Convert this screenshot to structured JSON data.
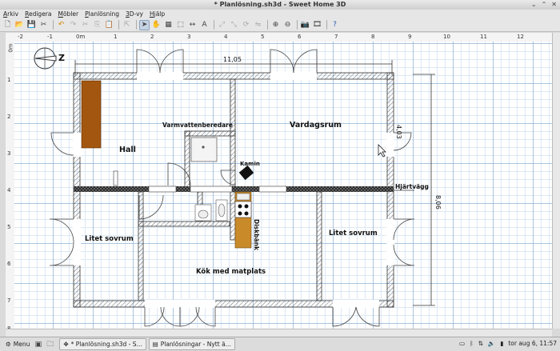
{
  "window": {
    "title": "* Planlösning.sh3d - Sweet Home 3D",
    "controls": [
      "⌄",
      "⌃",
      "✕"
    ]
  },
  "menu": [
    "Arkiv",
    "Redigera",
    "Möbler",
    "Planlösning",
    "3D-vy",
    "Hjälp"
  ],
  "toolbar": {
    "icons": [
      "new-icon",
      "open-icon",
      "save-icon",
      "cut-tools-icon",
      "sep",
      "undo-icon",
      "redo-icon",
      "cut-icon",
      "copy-icon",
      "paste-icon",
      "sep",
      "add-furniture-icon",
      "sep",
      "select-icon",
      "pan-icon",
      "create-walls-icon",
      "create-rooms-icon",
      "create-dimensions-icon",
      "add-text-icon",
      "sep",
      "enlarge-icon",
      "reduce-icon",
      "rotate-icon",
      "flip-icon",
      "sep",
      "zoom-in-icon",
      "zoom-out-icon",
      "sep",
      "photo-icon",
      "video-icon",
      "sep",
      "help-icon"
    ]
  },
  "ruler": {
    "top": [
      "-2",
      "-1",
      "0m",
      "1",
      "2",
      "3",
      "4",
      "5",
      "6",
      "7",
      "8",
      "9",
      "10",
      "11",
      "12"
    ],
    "left": [
      "0m",
      "1",
      "2",
      "3",
      "4",
      "5",
      "6",
      "7",
      "8"
    ]
  },
  "plan": {
    "compass_letter": "Z",
    "rooms": {
      "hall": "Hall",
      "vardagsrum": "Vardagsrum",
      "litet_sovrum_left": "Litet sovrum",
      "litet_sovrum_right": "Litet sovrum",
      "kok": "Kök med matplats"
    },
    "labels": {
      "varmvattenberedare": "Varmvattenberedare",
      "kamin": "Kamin",
      "diskbank": "Diskbänk",
      "hjartvagg": "Hjärtvägg"
    },
    "dimensions": {
      "width": "11,05",
      "height_total": "8,06",
      "height_part": "4,03"
    }
  },
  "taskbar": {
    "menu_label": "Menu",
    "tasks": [
      "* Planlösning.sh3d - S...",
      "Planlösningar - Nytt ä..."
    ],
    "clock": "tor aug  6, 11:57"
  }
}
